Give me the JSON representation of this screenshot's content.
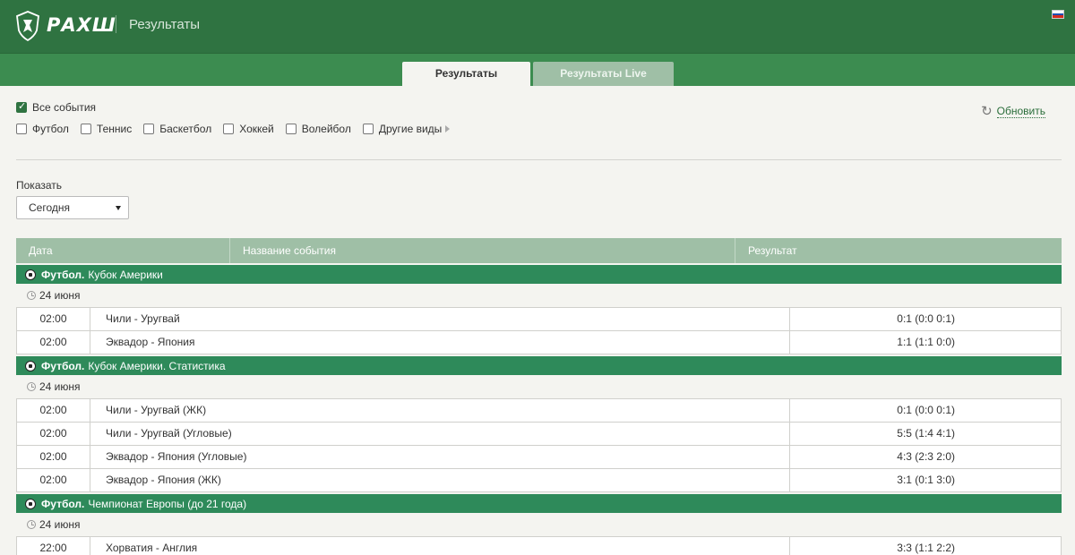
{
  "header": {
    "brand": "РАХШ",
    "title": "Результаты",
    "flag_colors": [
      "#ffffff",
      "#1f4fb4",
      "#d52b1e"
    ]
  },
  "tabs": [
    {
      "label": "Результаты",
      "active": true
    },
    {
      "label": "Результаты Live",
      "active": false
    }
  ],
  "filters": {
    "all": {
      "label": "Все события",
      "checked": true
    },
    "sports": [
      {
        "label": "Футбол",
        "checked": false
      },
      {
        "label": "Теннис",
        "checked": false
      },
      {
        "label": "Баскетбол",
        "checked": false
      },
      {
        "label": "Хоккей",
        "checked": false
      },
      {
        "label": "Волейбол",
        "checked": false
      },
      {
        "label": "Другие виды",
        "checked": false
      }
    ],
    "refresh_label": "Обновить"
  },
  "show": {
    "label": "Показать",
    "selected": "Сегодня"
  },
  "table": {
    "headers": {
      "date": "Дата",
      "name": "Название события",
      "result": "Результат"
    }
  },
  "groups": [
    {
      "sport": "Футбол.",
      "league": "Кубок Америки",
      "date": "24 июня",
      "events": [
        {
          "time": "02:00",
          "name": "Чили - Уругвай",
          "result": "0:1 (0:0 0:1)"
        },
        {
          "time": "02:00",
          "name": "Эквадор - Япония",
          "result": "1:1 (1:1 0:0)"
        }
      ]
    },
    {
      "sport": "Футбол.",
      "league": "Кубок Америки. Статистика",
      "date": "24 июня",
      "events": [
        {
          "time": "02:00",
          "name": "Чили - Уругвай (ЖК)",
          "result": "0:1 (0:0 0:1)"
        },
        {
          "time": "02:00",
          "name": "Чили - Уругвай (Угловые)",
          "result": "5:5 (1:4 4:1)"
        },
        {
          "time": "02:00",
          "name": "Эквадор - Япония (Угловые)",
          "result": "4:3 (2:3 2:0)"
        },
        {
          "time": "02:00",
          "name": "Эквадор - Япония (ЖК)",
          "result": "3:1 (0:1 3:0)"
        }
      ]
    },
    {
      "sport": "Футбол.",
      "league": "Чемпионат Европы (до 21 года)",
      "date": "24 июня",
      "events": [
        {
          "time": "22:00",
          "name": "Хорватия - Англия",
          "result": "3:3 (1:1 2:2)"
        }
      ]
    }
  ],
  "colors": {
    "header_green": "#2f7341",
    "tabbar_green": "#3c8c50",
    "category_green": "#2e8a5a",
    "thead_green": "#9fbfa6"
  }
}
